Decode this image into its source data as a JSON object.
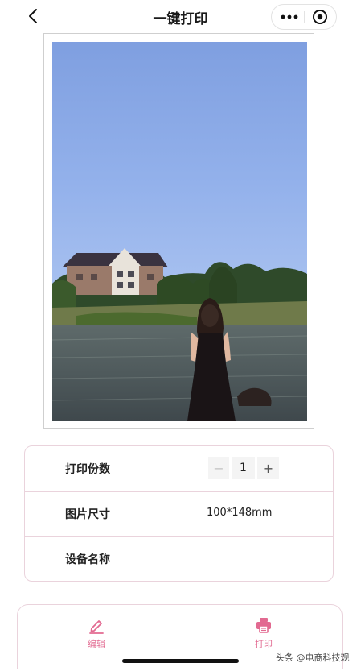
{
  "header": {
    "title": "一键打印"
  },
  "settings": {
    "copies_label": "打印份数",
    "copies_value": "1",
    "minus_symbol": "−",
    "plus_symbol": "+",
    "size_label": "图片尺寸",
    "size_value": "100*148mm",
    "device_label": "设备名称",
    "device_value": ""
  },
  "actions": {
    "edit_label": "编辑",
    "print_label": "打印"
  },
  "watermark": "头条 @电商科技观",
  "colors": {
    "accent": "#e26a91",
    "border": "#ead3dc"
  }
}
